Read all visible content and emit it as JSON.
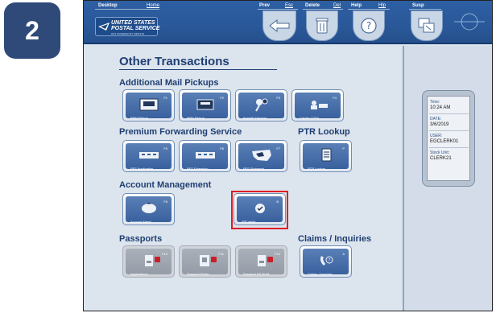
{
  "step": {
    "number": "2"
  },
  "topbar": {
    "desktop": {
      "label": "Desktop",
      "key": "Home"
    },
    "prev": {
      "label": "Prev",
      "key": "Esc"
    },
    "delete": {
      "label": "Delete",
      "key": "Del"
    },
    "help": {
      "label": "Help",
      "key": "Hlp"
    },
    "susp": {
      "label": "Susp"
    }
  },
  "logo": {
    "line1": "UNITED STATES",
    "line2": "POSTAL SERVICE",
    "line3": "RSS POWERED BY IMPASTE"
  },
  "page": {
    "title": "Other Transactions"
  },
  "sections": {
    "mail_pickups": "Additional Mail Pickups",
    "forwarding": "Premium Forwarding Service",
    "ptr": "PTR Lookup",
    "account": "Account Management",
    "passports": "Passports",
    "claims": "Claims / Inquiries"
  },
  "tiles": {
    "brm": {
      "label": "BRM Pickup",
      "fkey": "F1",
      "icon": "mail-pickup-icon"
    },
    "mrs": {
      "label": "MRS Pickup",
      "fkey": "F2",
      "icon": "mrs-pickup-icon"
    },
    "keys": {
      "label": "Keys/ID Devices",
      "fkey": "F3",
      "icon": "keys-icon"
    },
    "carrier": {
      "label": "Carrier CODs",
      "fkey": "F4",
      "icon": "carrier-cod-icon"
    },
    "pfs_app": {
      "label": "PFS Application",
      "fkey": "F5",
      "icon": "pfs-application-icon"
    },
    "pfs_ext": {
      "label": "PFS Extension",
      "fkey": "F6",
      "icon": "pfs-extension-icon"
    },
    "pfs_ship": {
      "label": "PFS Shipment",
      "fkey": "F7",
      "icon": "us-map-icon"
    },
    "ptr": {
      "label": "PTR Lookup",
      "fkey": "P",
      "icon": "document-icon"
    },
    "account": {
      "label": "Account Mgmt",
      "fkey": "F8",
      "icon": "piggy-bank-icon"
    },
    "ipp": {
      "label": "IPP Verify",
      "fkey": "B",
      "icon": "check-badge-icon"
    },
    "applications": {
      "label": "Applications",
      "fkey": "F10",
      "icon": "passport-icon"
    },
    "passport_photo": {
      "label": "Passport Photo",
      "fkey": "F11",
      "icon": "passport-photo-icon"
    },
    "passport_ps": {
      "label": "Passport PS NUM",
      "fkey": "F12",
      "icon": "passport-num-icon"
    },
    "claims": {
      "label": "Claims / Inquiries",
      "fkey": "A",
      "icon": "phone-help-icon"
    }
  },
  "status": {
    "time_label": "Time:",
    "time": "10:24 AM",
    "date_label": "DATE:",
    "date": "3/6/2019",
    "user_label": "USER:",
    "user": "EGCLERK01",
    "stock_label": "Stock Unit:",
    "stock": "CLERK21"
  },
  "colors": {
    "badge": "#2f4a78",
    "topbar": "#2a5899",
    "highlight": "#e01c24",
    "heading": "#1f3f72"
  }
}
